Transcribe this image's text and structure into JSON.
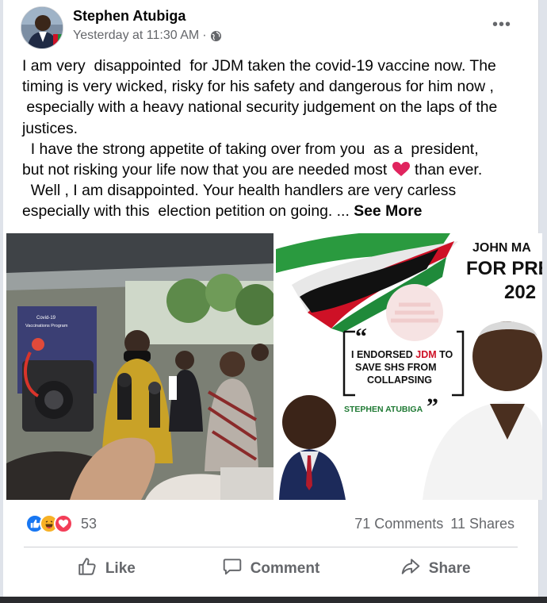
{
  "post": {
    "author": "Stephen Atubiga",
    "timestamp": "Yesterday at 11:30 AM",
    "meta_separator": "·",
    "privacy_icon": "globe-icon",
    "more_icon": "ellipsis-icon",
    "text_lines": [
      "I am very  disappointed  for JDM taken the covid-19 vaccine now. The",
      "timing is very wicked, risky for his safety and dangerous for him now ,",
      " especially with a heavy national security judgement on the laps of the",
      "justices.",
      "  I have the strong appetite of taking over from you  as a  president,",
      "but not risking your life now that you are needed most",
      " than ever.",
      "  Well , I am disappointed. Your health handlers are very carless",
      "especially with this  election petition on going. ...",
      "See More"
    ]
  },
  "photos": {
    "left": {
      "banner_line1": "Covid-19",
      "banner_line2": "Vaccinations Program"
    },
    "right": {
      "name_line": "JOHN MA",
      "for_line": "FOR PRES",
      "year_line": "202",
      "quote_open": "“",
      "quote_close": "”",
      "quote_l1_a": "I ENDORSED ",
      "quote_l1_b": "JDM",
      "quote_l1_c": " TO",
      "quote_l2": "SAVE SHS FROM",
      "quote_l3": "COLLAPSING",
      "signature": "STEPHEN ATUBIGA"
    }
  },
  "stats": {
    "reactions": [
      "like-icon",
      "haha-icon",
      "love-icon"
    ],
    "reaction_count": "53",
    "comments": "71 Comments",
    "shares": "11 Shares"
  },
  "actions": {
    "like": "Like",
    "comment": "Comment",
    "share": "Share"
  },
  "colors": {
    "like_blue": "#1877f2",
    "love_red": "#f33e58",
    "haha_yellow": "#f7b125",
    "ndc_red": "#ce1126",
    "ndc_green": "#1f8a3a",
    "heart_red": "#e0245e"
  }
}
